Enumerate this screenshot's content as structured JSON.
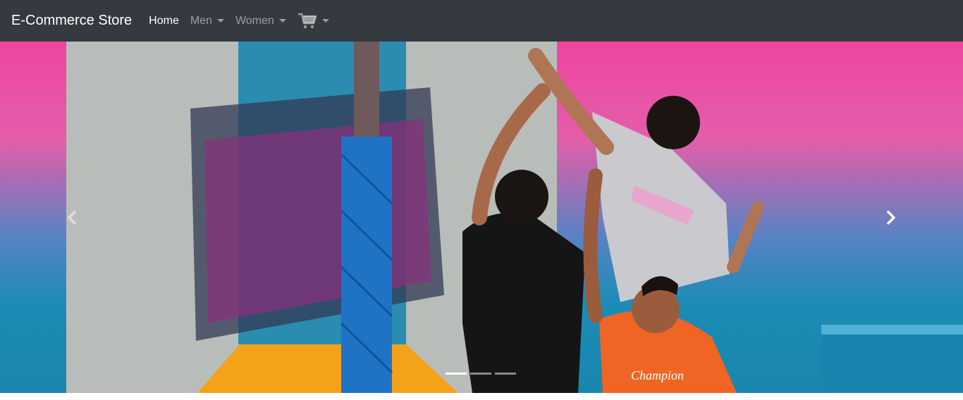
{
  "navbar": {
    "brand": "E-Commerce Store",
    "links": [
      {
        "label": "Home",
        "active": true
      },
      {
        "label": "Men",
        "dropdown": true
      },
      {
        "label": "Women",
        "dropdown": true
      }
    ],
    "cart_icon": "shopping-cart-icon"
  },
  "carousel": {
    "image_subject": "basketball players jumping in front of colorful wall",
    "slide_count": 3,
    "active_index": 0,
    "prev_icon": "chevron-left-icon",
    "next_icon": "chevron-right-icon",
    "shirt_text": "Champion"
  },
  "colors": {
    "navbar_bg": "#343a40",
    "nav_active": "#ffffff",
    "nav_inactive": "rgba(255,255,255,0.5)",
    "wall_pink": "#ec4aa0",
    "wall_blue": "#1f8ab4"
  }
}
